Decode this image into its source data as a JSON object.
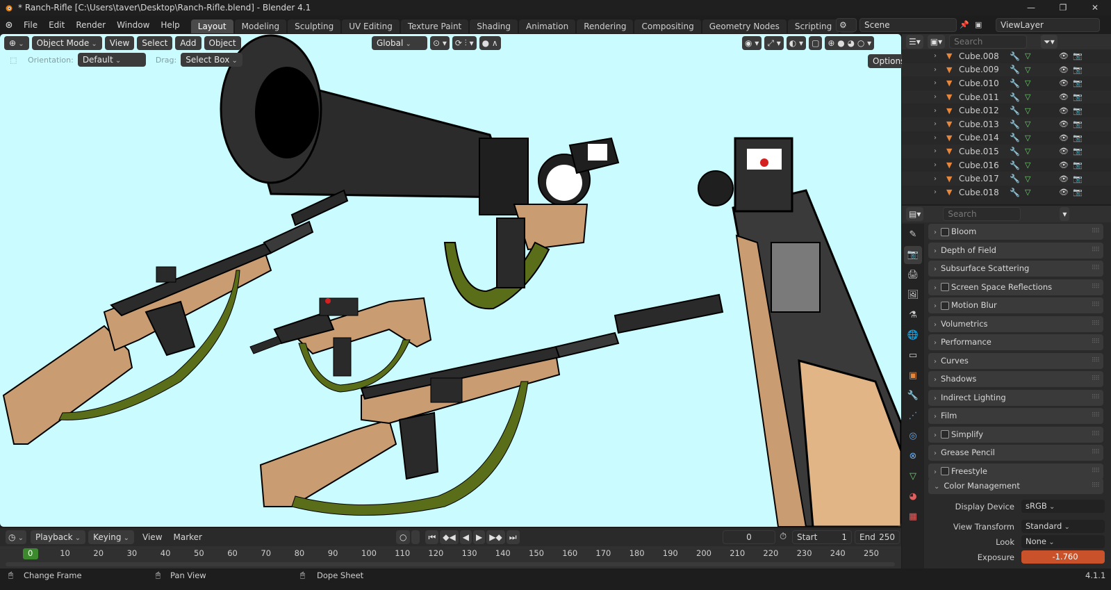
{
  "window": {
    "title": "* Ranch-Rifle [C:\\Users\\taver\\Desktop\\Ranch-Rifle.blend] - Blender 4.1",
    "controls": [
      "—",
      "❐",
      "✕"
    ]
  },
  "menu": [
    "File",
    "Edit",
    "Render",
    "Window",
    "Help"
  ],
  "workspace_tabs": [
    "Layout",
    "Modeling",
    "Sculpting",
    "UV Editing",
    "Texture Paint",
    "Shading",
    "Animation",
    "Rendering",
    "Compositing",
    "Geometry Nodes",
    "Scripting"
  ],
  "active_tab": "Layout",
  "scene": {
    "label": "Scene",
    "view_layer": "ViewLayer"
  },
  "viewport": {
    "mode": "Object Mode",
    "menus": [
      "View",
      "Select",
      "Add",
      "Object"
    ],
    "transform_orientation": "Global",
    "orientation_label": "Orientation:",
    "orientation_value": "Default",
    "drag_label": "Drag:",
    "drag_value": "Select Box",
    "options_label": "Options",
    "background_color": "#c9fbff"
  },
  "outliner": {
    "search_placeholder": "Search",
    "items": [
      "Cube.008",
      "Cube.009",
      "Cube.010",
      "Cube.011",
      "Cube.012",
      "Cube.013",
      "Cube.014",
      "Cube.015",
      "Cube.016",
      "Cube.017",
      "Cube.018"
    ]
  },
  "properties": {
    "search_placeholder": "Search",
    "panels": [
      {
        "label": "Bloom",
        "checkbox": true
      },
      {
        "label": "Depth of Field",
        "checkbox": false
      },
      {
        "label": "Subsurface Scattering",
        "checkbox": false
      },
      {
        "label": "Screen Space Reflections",
        "checkbox": true
      },
      {
        "label": "Motion Blur",
        "checkbox": true
      },
      {
        "label": "Volumetrics",
        "checkbox": false
      },
      {
        "label": "Performance",
        "checkbox": false
      },
      {
        "label": "Curves",
        "checkbox": false
      },
      {
        "label": "Shadows",
        "checkbox": false
      },
      {
        "label": "Indirect Lighting",
        "checkbox": false
      },
      {
        "label": "Film",
        "checkbox": false
      },
      {
        "label": "Simplify",
        "checkbox": true
      },
      {
        "label": "Grease Pencil",
        "checkbox": false
      },
      {
        "label": "Freestyle",
        "checkbox": true
      }
    ],
    "color_management": {
      "label": "Color Management",
      "display_device_label": "Display Device",
      "display_device": "sRGB",
      "view_transform_label": "View Transform",
      "view_transform": "Standard",
      "look_label": "Look",
      "look": "None",
      "exposure_label": "Exposure",
      "exposure": "-1.760"
    }
  },
  "timeline": {
    "menus": [
      "Playback",
      "Keying",
      "View",
      "Marker"
    ],
    "current_frame": "0",
    "start_label": "Start",
    "start": "1",
    "end_label": "End",
    "end": "250",
    "ticks": [
      "0",
      "10",
      "20",
      "30",
      "40",
      "50",
      "60",
      "70",
      "80",
      "90",
      "100",
      "110",
      "120",
      "130",
      "140",
      "150",
      "160",
      "170",
      "180",
      "190",
      "200",
      "210",
      "220",
      "230",
      "240",
      "250"
    ]
  },
  "statusbar": {
    "items": [
      "Change Frame",
      "Pan View",
      "Dope Sheet"
    ],
    "version": "4.1.1"
  }
}
